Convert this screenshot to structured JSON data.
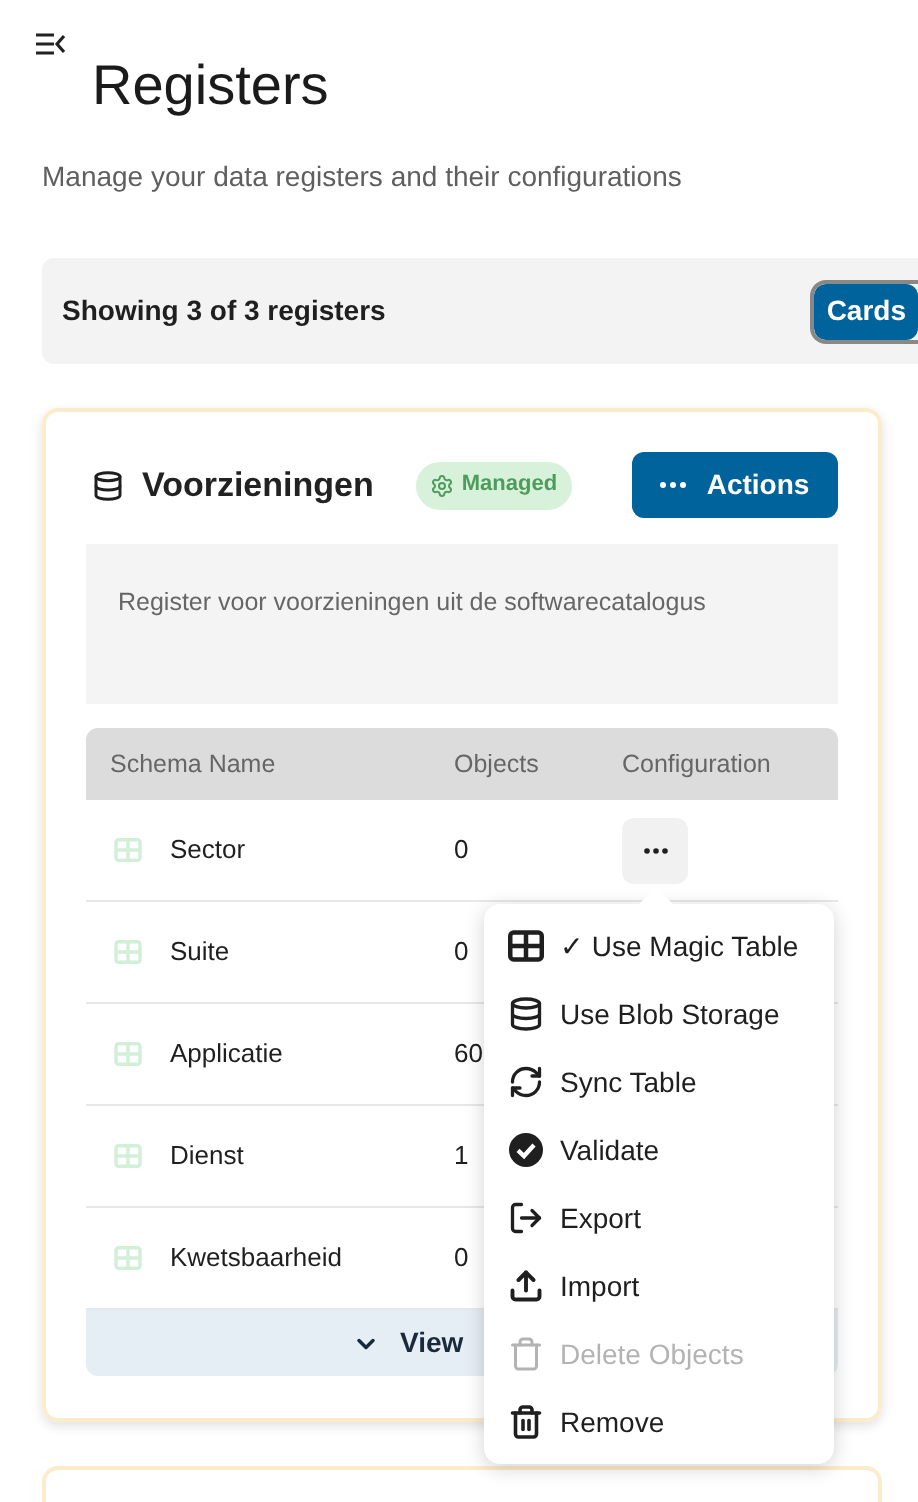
{
  "page": {
    "title": "Registers",
    "subtitle": "Manage your data registers and their configurations"
  },
  "toolbar": {
    "count": "Showing 3 of 3 registers",
    "view_toggle": [
      {
        "label": "Cards",
        "selected": true
      }
    ]
  },
  "register": {
    "title": "Voorzieningen",
    "badge": "Managed",
    "actions": "Actions",
    "description": "Register voor voorzieningen uit de softwarecatalogus",
    "columns": [
      "Schema Name",
      "Objects",
      "Configuration"
    ],
    "rows": [
      {
        "name": "Sector",
        "objects": "0"
      },
      {
        "name": "Suite",
        "objects": "0"
      },
      {
        "name": "Applicatie",
        "objects": "60"
      },
      {
        "name": "Dienst",
        "objects": "1"
      },
      {
        "name": "Kwetsbaarheid",
        "objects": "0"
      }
    ],
    "view_more": "View"
  },
  "menu": {
    "items": [
      {
        "kind": "table",
        "label": "✓ Use Magic Table",
        "disabled": false
      },
      {
        "kind": "database",
        "label": "Use Blob Storage",
        "disabled": false
      },
      {
        "kind": "sync",
        "label": "Sync Table",
        "disabled": false
      },
      {
        "kind": "validate",
        "label": "Validate",
        "disabled": false
      },
      {
        "kind": "export",
        "label": "Export",
        "disabled": false
      },
      {
        "kind": "import",
        "label": "Import",
        "disabled": false
      },
      {
        "kind": "delete",
        "label": "Delete Objects",
        "disabled": true
      },
      {
        "kind": "remove",
        "label": "Remove",
        "disabled": false
      }
    ]
  }
}
